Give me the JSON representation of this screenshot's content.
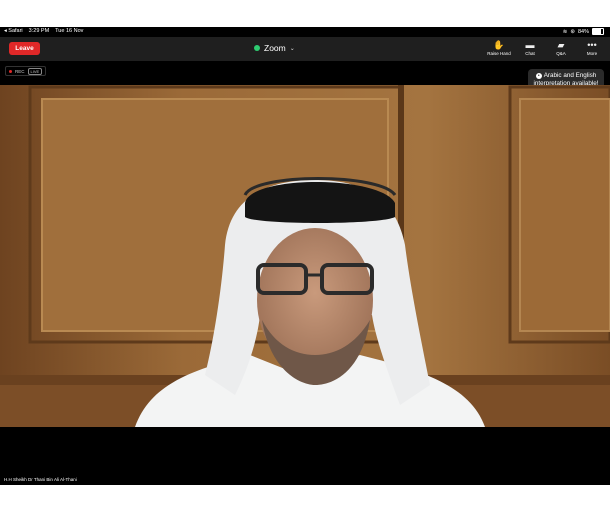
{
  "status_bar": {
    "back_app": "◂ Safari",
    "time": "3:29 PM",
    "date": "Tue 16 Nov",
    "battery": "84%"
  },
  "toolbar": {
    "leave_label": "Leave",
    "app_title": "Zoom",
    "buttons": [
      {
        "icon": "raise-hand-icon",
        "label": "Raise Hand"
      },
      {
        "icon": "chat-icon",
        "label": "Chat"
      },
      {
        "icon": "qa-icon",
        "label": "Q&A"
      },
      {
        "icon": "more-icon",
        "label": "More"
      }
    ]
  },
  "recording": {
    "rec_label": "REC",
    "live_label": "LIVE"
  },
  "tooltip": {
    "text_line1": "Arabic and English",
    "text_line2": "interpretation available!"
  },
  "speaker": {
    "name": "H.H Sheikh Dr Thani Bin Ali Al-Thani"
  },
  "colors": {
    "leave": "#e02828",
    "toolbar_bg": "#1f1f1f",
    "secure": "#2ecc71",
    "panel": "#8a5a2e"
  }
}
